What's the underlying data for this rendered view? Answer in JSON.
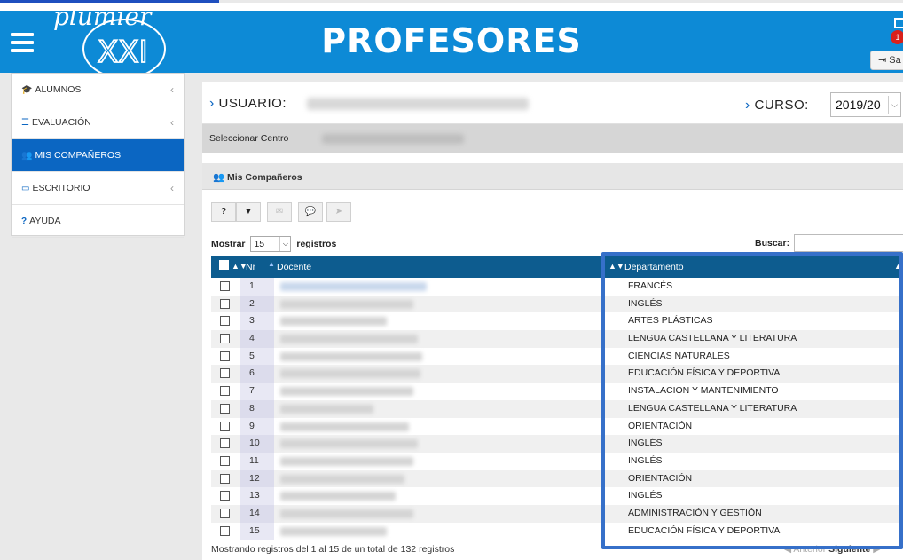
{
  "header": {
    "title": "PROFESORES",
    "logo_text": "plumierXXI",
    "mail_badge": "1",
    "salir_label": "Sa"
  },
  "sidebar": {
    "items": [
      {
        "label": "ALUMNOS",
        "icon": "graduation-cap-icon",
        "chevron": "‹"
      },
      {
        "label": "EVALUACIÓN",
        "icon": "list-icon",
        "chevron": "‹"
      },
      {
        "label": "MIS COMPAÑEROS",
        "icon": "users-icon",
        "chevron": ""
      },
      {
        "label": "ESCRITORIO",
        "icon": "desktop-icon",
        "chevron": "‹"
      },
      {
        "label": "AYUDA",
        "icon": "question-icon",
        "chevron": ""
      }
    ]
  },
  "top_bar": {
    "usuario_label": "USUARIO:",
    "curso_label": "CURSO:",
    "curso_value": "2019/20",
    "centro_label": "Seleccionar Centro"
  },
  "panel": {
    "title": "Mis Compañeros",
    "toolbar": [
      "?",
      "▼",
      "✉",
      "💬",
      "➤"
    ],
    "mostrar_label": "Mostrar",
    "mostrar_value": "15",
    "registros_label": "registros",
    "buscar_label": "Buscar:",
    "columns": {
      "nr": "Nr",
      "docente": "Docente",
      "departamento": "Departamento"
    },
    "rows": [
      {
        "nr": "1",
        "departamento": "FRANCÉS"
      },
      {
        "nr": "2",
        "departamento": "INGLÉS"
      },
      {
        "nr": "3",
        "departamento": "ARTES PLÁSTICAS"
      },
      {
        "nr": "4",
        "departamento": "LENGUA CASTELLANA Y LITERATURA"
      },
      {
        "nr": "5",
        "departamento": "CIENCIAS NATURALES"
      },
      {
        "nr": "6",
        "departamento": "EDUCACIÓN FÍSICA Y DEPORTIVA"
      },
      {
        "nr": "7",
        "departamento": "INSTALACION Y MANTENIMIENTO"
      },
      {
        "nr": "8",
        "departamento": "LENGUA CASTELLANA Y LITERATURA"
      },
      {
        "nr": "9",
        "departamento": "ORIENTACIÓN"
      },
      {
        "nr": "10",
        "departamento": "INGLÉS"
      },
      {
        "nr": "11",
        "departamento": "INGLÉS"
      },
      {
        "nr": "12",
        "departamento": "ORIENTACIÓN"
      },
      {
        "nr": "13",
        "departamento": "INGLÉS"
      },
      {
        "nr": "14",
        "departamento": "ADMINISTRACIÓN Y GESTIÓN"
      },
      {
        "nr": "15",
        "departamento": "EDUCACIÓN FÍSICA Y DEPORTIVA"
      }
    ],
    "info": "Mostrando registros del 1 al 15 de un total de 132 registros",
    "prev": "Anterior",
    "next": "Siguiente"
  },
  "colors": {
    "header": "#0d8ad6",
    "active": "#0b66c2",
    "table_head": "#0d5c8f",
    "highlight": "#3670c9"
  }
}
